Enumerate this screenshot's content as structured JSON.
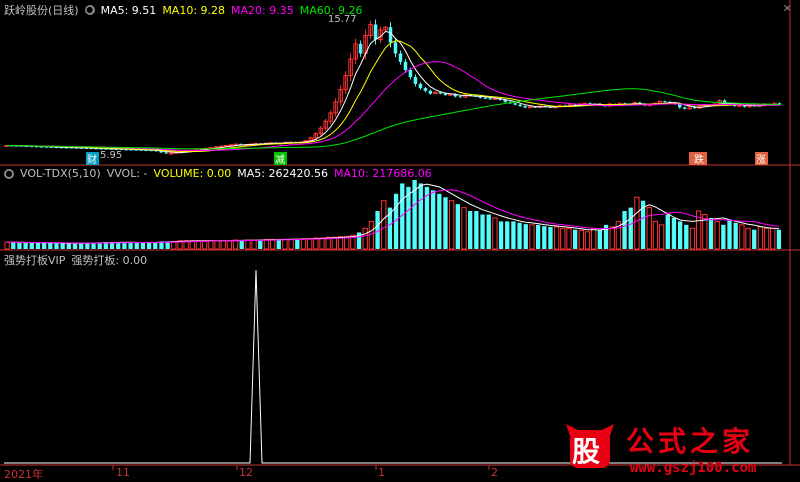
{
  "panel1": {
    "title": "跃岭股份(日线)",
    "ma5": "MA5: 9.51",
    "ma10": "MA10: 9.28",
    "ma20": "MA20: 9.35",
    "ma60": "MA60: 9.26",
    "high_label": "15.77",
    "low_label": "5.95",
    "markers": [
      "财",
      "减",
      "跌",
      "涨"
    ]
  },
  "panel2": {
    "name": "VOL-TDX(5,10)",
    "vvol": "VVOL: -",
    "volume": "VOLUME: 0.00",
    "ma5": "MA5: 262420.56",
    "ma10": "MA10: 217686.06"
  },
  "panel3": {
    "name": "强势打板VIP",
    "value": "强势打板: 0.00"
  },
  "x_axis": {
    "labels": [
      "2021年",
      "11",
      "12",
      "1",
      "2"
    ]
  },
  "watermark": {
    "logo_char": "股",
    "title": "公式之家",
    "url": "www.gszj100.com"
  },
  "colors": {
    "up": "#ff3232",
    "down": "#54fcfc",
    "ma5": "#ffffff",
    "ma10": "#ffff00",
    "ma20": "#ff00ff",
    "ma60": "#00e600",
    "axis": "#c83232",
    "text_gray": "#c0c0c0"
  },
  "chart_data": [
    {
      "type": "candlestick",
      "title": "跃岭股份(日线)",
      "close": [
        6.55,
        6.54,
        6.53,
        6.51,
        6.5,
        6.49,
        6.47,
        6.46,
        6.45,
        6.44,
        6.42,
        6.41,
        6.4,
        6.39,
        6.38,
        6.37,
        6.36,
        6.34,
        6.33,
        6.32,
        6.31,
        6.3,
        6.29,
        6.27,
        6.26,
        6.25,
        6.24,
        6.22,
        6.21,
        6.2,
        6.15,
        6.05,
        5.98,
        6.0,
        6.05,
        6.1,
        6.15,
        6.2,
        6.25,
        6.3,
        6.35,
        6.4,
        6.45,
        6.5,
        6.55,
        6.6,
        6.65,
        6.6,
        6.62,
        6.65,
        6.7,
        6.68,
        6.72,
        6.75,
        6.7,
        6.73,
        6.78,
        6.8,
        6.75,
        6.8,
        6.9,
        7.1,
        7.4,
        7.8,
        8.3,
        8.9,
        9.7,
        10.6,
        11.6,
        12.8,
        13.9,
        13.2,
        14.5,
        15.3,
        14.2,
        14.9,
        15.1,
        14.0,
        13.2,
        12.6,
        12.0,
        11.5,
        11.0,
        10.7,
        10.5,
        10.3,
        10.4,
        10.3,
        10.2,
        10.25,
        10.1,
        10.05,
        10.2,
        10.15,
        10.1,
        10.0,
        9.95,
        9.9,
        9.95,
        9.85,
        9.7,
        9.6,
        9.5,
        9.4,
        9.3,
        9.35,
        9.3,
        9.4,
        9.35,
        9.3,
        9.35,
        9.45,
        9.4,
        9.5,
        9.45,
        9.55,
        9.6,
        9.5,
        9.55,
        9.45,
        9.4,
        9.55,
        9.5,
        9.6,
        9.55,
        9.5,
        9.65,
        9.55,
        9.45,
        9.5,
        9.6,
        9.75,
        9.7,
        9.65,
        9.55,
        9.3,
        9.2,
        9.35,
        9.25,
        9.4,
        9.5,
        9.45,
        9.55,
        9.8,
        9.6,
        9.5,
        9.4,
        9.45,
        9.35,
        9.5,
        9.4,
        9.45,
        9.55,
        9.5,
        9.6,
        9.51
      ],
      "ma_lines": [
        "MA5",
        "MA10",
        "MA20",
        "MA60"
      ],
      "high_annotation": 15.77,
      "low_annotation": 5.95
    },
    {
      "type": "bar",
      "title": "VOL-TDX(5,10)",
      "values": [
        10,
        10,
        9,
        9,
        9,
        9,
        9,
        9,
        8,
        8,
        8,
        8,
        9,
        9,
        9,
        9,
        10,
        10,
        10,
        10,
        9,
        9,
        9,
        10,
        10,
        11,
        11,
        11,
        12,
        12,
        12,
        12,
        12,
        12,
        12,
        12,
        12,
        13,
        13,
        13,
        13,
        13,
        14,
        14,
        14,
        14,
        14,
        15,
        15,
        15,
        16,
        16,
        17,
        17,
        18,
        18,
        20,
        24,
        30,
        40,
        55,
        70,
        60,
        80,
        95,
        90,
        100,
        95,
        90,
        85,
        80,
        75,
        70,
        65,
        60,
        55,
        55,
        50,
        50,
        45,
        40,
        40,
        40,
        38,
        36,
        35,
        35,
        33,
        32,
        32,
        30,
        30,
        28,
        27,
        25,
        30,
        28,
        35,
        32,
        40,
        55,
        60,
        75,
        70,
        60,
        40,
        35,
        50,
        45,
        40,
        35,
        30,
        55,
        50,
        45,
        40,
        35,
        42,
        38,
        35,
        30,
        28,
        32,
        30,
        30,
        28
      ],
      "ma_lines": [
        "MA5",
        "MA10"
      ]
    },
    {
      "type": "line",
      "title": "强势打板VIP",
      "values": [
        0,
        1,
        0
      ],
      "x_labels": [
        "2021年",
        "11",
        "12",
        "1",
        "2"
      ]
    }
  ]
}
